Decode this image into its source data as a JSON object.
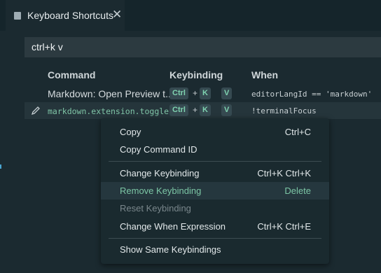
{
  "tab": {
    "title": "Keyboard Shortcuts",
    "close": "✕"
  },
  "search": {
    "value": "ctrl+k v"
  },
  "table": {
    "headers": {
      "command": "Command",
      "keybinding": "Keybinding",
      "when": "When"
    },
    "rows": [
      {
        "command": "Markdown: Open Preview t...",
        "keys": [
          "Ctrl",
          "K",
          "V"
        ],
        "plus": "+",
        "when": "editorLangId == 'markdown'"
      },
      {
        "command": "markdown.extension.toggle...",
        "keys": [
          "Ctrl",
          "K",
          "V"
        ],
        "plus": "+",
        "when": "!terminalFocus"
      }
    ]
  },
  "context_menu": {
    "items": [
      {
        "label": "Copy",
        "shortcut": "Ctrl+C"
      },
      {
        "label": "Copy Command ID",
        "shortcut": ""
      },
      {
        "label": "Change Keybinding",
        "shortcut": "Ctrl+K Ctrl+K"
      },
      {
        "label": "Remove Keybinding",
        "shortcut": "Delete",
        "state": "active"
      },
      {
        "label": "Reset Keybinding",
        "shortcut": "",
        "state": "disabled"
      },
      {
        "label": "Change When Expression",
        "shortcut": "Ctrl+K Ctrl+E"
      },
      {
        "label": "Show Same Keybindings",
        "shortcut": ""
      }
    ]
  },
  "colors": {
    "accent": "#7fc4a6",
    "background": "#1b2a30",
    "menu": "#1a2a2f"
  }
}
